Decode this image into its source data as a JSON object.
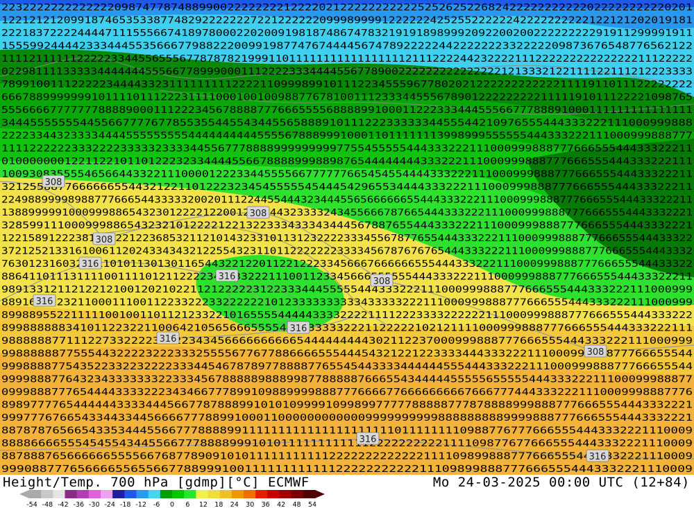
{
  "title_left": "Height/Temp. 700 hPa [gdmp][°C] ECMWF",
  "title_right": "Mo 24-03-2025 00:00 UTC (12+84)",
  "isohypse_labels": [
    "308",
    "308",
    "308",
    "308",
    "316",
    "316",
    "316",
    "316",
    "316",
    "308",
    "316",
    "316"
  ],
  "legend": {
    "ticks": [
      "-54",
      "-48",
      "-42",
      "-36",
      "-30",
      "-24",
      "-18",
      "-12",
      "-6",
      "0",
      "6",
      "12",
      "18",
      "24",
      "30",
      "36",
      "42",
      "48",
      "54"
    ],
    "colors": [
      "#aaaaaa",
      "#c8c8c8",
      "#e4e4e4",
      "#8c2a8c",
      "#b43cb4",
      "#e060e0",
      "#f0a0f0",
      "#1e1ea0",
      "#1e5ae6",
      "#2a9af0",
      "#46d2f0",
      "#00a000",
      "#00c800",
      "#28e628",
      "#f0f050",
      "#f0dc3c",
      "#f0be28",
      "#f09600",
      "#f06e00",
      "#e61e00",
      "#c80000",
      "#a00000",
      "#780000",
      "#500000"
    ]
  },
  "digit_rows": [
    "22322222222222220987477874889900222222221222202122222222222525262522682422222222222022222222220201",
    "1221212120991874653533877482922222227221222222099989999122222242525522222242222222222122121202019181",
    "2221837222244447111555667418978000220200919818748674783219191898999209220020022222222291911299991911",
    "15559924444233344455356667798822200991987747674444567478922222442222222332222209873676548776562122",
    "11112111111222223344556555677878782199911011111111111111111211122224423222211122222222222222211122222",
    "02298111133333444444455566778999000111222233344445567789002222222222222221213332122111122111212223333",
    "789910011122222344443323111111111222211099989910111223455596778020212222222222221111911011122222222",
    "6667889999999101111011122231111000100100988776781001112333445556789012222222221111191011122221098765",
    "5556666777777788889000111222345678888777666555568888991000112223334445556677788891000111111111111111",
    "3444555555544556677776778553554455434455658889101112223333334455544210976555444333222111000999888",
    "2222334432333344445555555554444444444555567888999100011011111113998999555555444333222111000999888777",
    "111122222233322223333323333445567778888999999999775545555544433322211100099988877766655544433322211",
    "010000000122112210110122232334444556678888999889876544444444333222111000999888777666555444333222111",
    "1009308355554656644332211100001222334455556677777766545455444433322211100099988877766655544433322211",
    "32125588776666665544321221101222323454555554544454296553444433322211100099988877766655544433322211",
    "22498899998988777666544333332002011122445544432344455656666665544433322211100099988877766655544433322211",
    "1388999991000999886543230122221220012235443233332434556667876654443332221110009998887776665554443332221",
    "328599111000999886543232101222212213223334333434445678876554443332221110009998887776665554443332221",
    "1221589122238110522122368532112101432331011312322223334556787765544433322211100099988877766655544433322",
    "3721252133161006112024334343212255432311011222222233334567876767654443332221110009998887776665554443332",
    "763012316032111101011301301165443221220112212223345666766666655544433322211100099988877766655544433322",
    "88641101113111100111101211222234543322211100112334566655555544433322211100099988877766655544433322211",
    "989133121121221210012021022112122222312233344455555444333222111000999888777666555444333222111000999",
    "8891612223211000111001122332223322222210123333333333433333222111000999888777666555444333222111000999",
    "8998895522111110010011011212332210165555444443333222211112223333222222111000999888777666555444333222",
    "8998888883410112232211006421056566655554444333332221122222102121111000999888777666555444333222111",
    "988888877111227332222322223434566666666665444444444302112237000999888777666555444333222111000999",
    "998888887755544322223222333255556776778866665554445432122122333344433322211100099988877766655544",
    "9998888775435223322322223334454678789778888776554544333344444455544433322211100099988877766655544",
    "9999888776432343333333223334567888889888998778888876665543444445555565555544433322211100099988877",
    "0999888777654444333322234346677789910988999988877766667766666666676667774443332221110009998887776",
    "898977776544444433334445667787888991010109999109989977777888887778788889998887776665554443332221",
    "99977767665433443344566667778899100011000000000000999999999988888888899998887776665554443332221",
    "88787876566543353444556677788889911111111111111111111101111111109887767776665554443332221110009",
    "8888666655545455434455667778888999101011111111111122222222221111098776776665554443332221110009",
    "88788876566666655556676877890910101111111111122222222222221111098998887776665554443332221110009",
    "9990887776566665565566778899910011111111111122222222222111098998887776665554443332221110009"
  ]
}
